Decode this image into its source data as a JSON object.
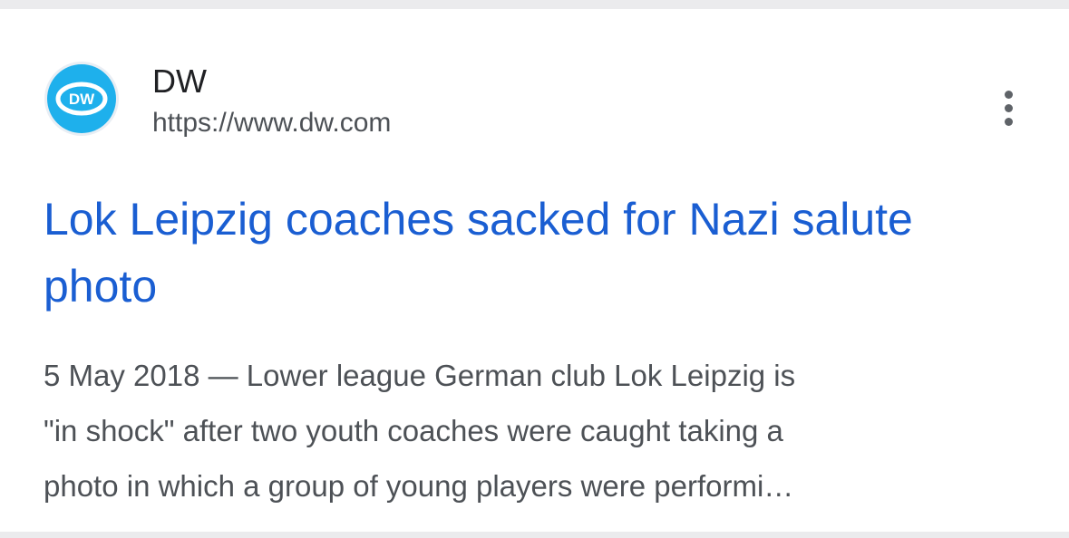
{
  "result": {
    "site_name": "DW",
    "site_url": "https://www.dw.com",
    "favicon_icon": "dw-logo-icon",
    "favicon_color": "#1eb0ec",
    "more_icon": "more-vert-icon",
    "headline": "Lok Leipzig coaches sacked for Nazi salute photo",
    "headline_color": "#1a5ed2",
    "snippet_lines": [
      "5 May 2018 — Lower league German club Lok Leipzig is",
      "\"in shock\" after two youth coaches were caught taking a",
      "photo in which a group of young players were performi…"
    ]
  }
}
